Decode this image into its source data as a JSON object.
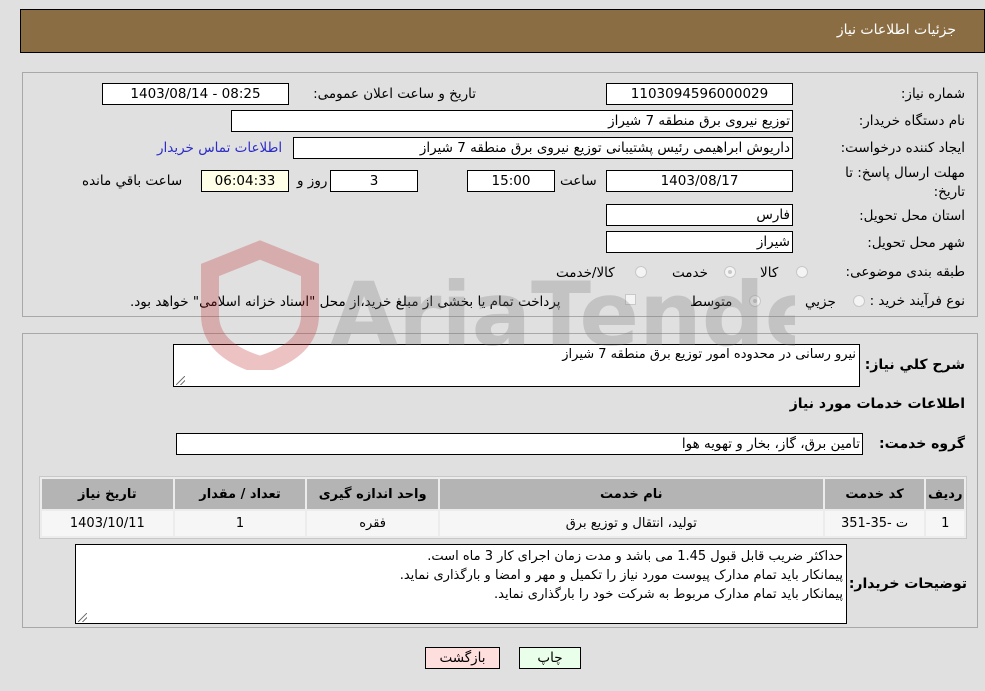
{
  "header": {
    "title": "جزئیات اطلاعات نیاز"
  },
  "form": {
    "need_number": {
      "label": "شماره نیاز:",
      "value": "1103094596000029"
    },
    "announce_datetime": {
      "label": "تاریخ و ساعت اعلان عمومی:",
      "value": "1403/08/14 - 08:25"
    },
    "buyer_org": {
      "label": "نام دستگاه خریدار:",
      "value": "توزیع نیروی برق منطقه 7 شیراز"
    },
    "requester": {
      "label": "ایجاد کننده درخواست:",
      "value": "داریوش ابراهیمی رئیس پشتیبانی توزیع نیروی برق منطقه 7 شیراز",
      "contact_link": "اطلاعات تماس خریدار"
    },
    "deadline": {
      "label": "مهلت ارسال پاسخ: تا تاریخ:",
      "date": "1403/08/17",
      "time_label": "ساعت",
      "time": "15:00",
      "days": "3",
      "days_label": "روز و",
      "remaining": "06:04:33",
      "remaining_label": "ساعت باقي مانده"
    },
    "province": {
      "label": "استان محل تحویل:",
      "value": "فارس"
    },
    "city": {
      "label": "شهر محل تحویل:",
      "value": "شیراز"
    },
    "category": {
      "label": "طبقه بندی موضوعی:",
      "options": [
        {
          "label": "کالا",
          "selected": false
        },
        {
          "label": "خدمت",
          "selected": true
        },
        {
          "label": "کالا/خدمت",
          "selected": false
        }
      ]
    },
    "purchase_type": {
      "label": "نوع فرآیند خرید :",
      "options": [
        {
          "label": "جزيي",
          "selected": false
        },
        {
          "label": "متوسط",
          "selected": true
        }
      ],
      "treasury_checkbox_label": "پرداخت تمام یا بخشی از مبلغ خرید،از محل \"اسناد خزانه اسلامی\" خواهد بود.",
      "treasury_checked": false
    }
  },
  "details": {
    "summary_label": "شرح کلي نیاز:",
    "summary_value": "نیرو رسانی در محدوده امور توزیع برق منطقه 7 شیراز",
    "services_heading": "اطلاعات خدمات مورد نیاز",
    "service_group_label": "گروه خدمت:",
    "service_group_value": "تامین برق، گاز، بخار و تهویه هوا",
    "table": {
      "headers": [
        "ردیف",
        "کد خدمت",
        "نام خدمت",
        "واحد اندازه گیری",
        "تعداد / مقدار",
        "تاریخ نیاز"
      ],
      "rows": [
        [
          "1",
          "ت -35-351",
          "تولید، انتقال و توزیع برق",
          "فقره",
          "1",
          "1403/10/11"
        ]
      ]
    },
    "buyer_notes_label": "توضیحات خریدار:",
    "buyer_notes": [
      "حداکثر ضریب قابل قبول 1.45 می باشد و مدت زمان اجرای کار 3 ماه است.",
      "پیمانکار باید تمام مدارک پیوست مورد نیاز را تکمیل و مهر و امضا و بارگذاری نماید.",
      "پیمانکار باید تمام مدارک مربوط به شرکت خود را بارگذاری نماید."
    ]
  },
  "buttons": {
    "print": "چاپ",
    "back": "بازگشت"
  },
  "watermark": {
    "text": "AriaTender.neT"
  },
  "colors": {
    "header_bg": "#8b6d43",
    "print_bg": "#eaffea",
    "back_bg": "#ffdede",
    "link": "#2c2cc8"
  }
}
